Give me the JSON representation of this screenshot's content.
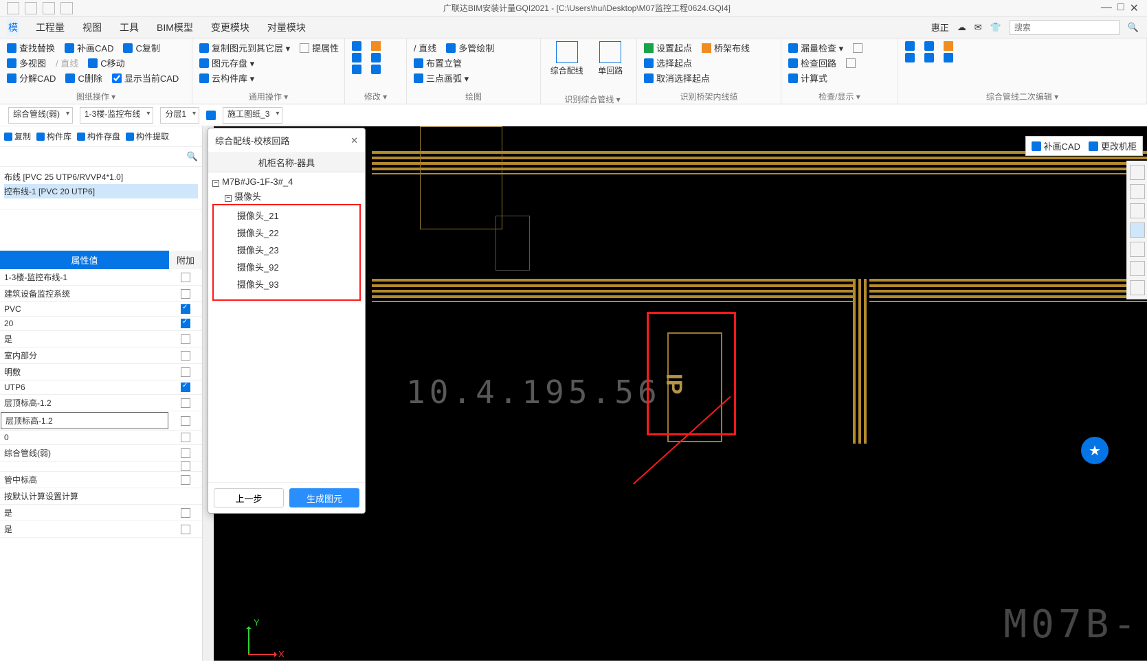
{
  "titlebar": {
    "title": "广联达BIM安装计量GQI2021 - [C:\\Users\\hui\\Desktop\\M07监控工程0624.GQI4]",
    "min": "—",
    "max": "□",
    "close": "✕"
  },
  "menubar": {
    "tabs": [
      "模",
      "工程量",
      "视图",
      "工具",
      "BIM模型",
      "变更模块",
      "对量模块"
    ],
    "user": "惠正",
    "search_placeholder": "搜索"
  },
  "ribbon": {
    "g_draw": {
      "label": "图纸操作 ▾",
      "r1": [
        "查找替换",
        "补画CAD",
        "C复制"
      ],
      "r2": [
        "多视图",
        "/ 直线",
        "C移动"
      ],
      "r3": [
        "分解CAD",
        "C删除"
      ],
      "chkShowCad": "显示当前CAD"
    },
    "g_common": {
      "label": "通用操作 ▾",
      "r1": [
        "复制图元到其它层 ▾",
        "提属性"
      ],
      "r2": [
        "图元存盘 ▾"
      ],
      "r3": [
        "云构件库 ▾"
      ]
    },
    "g_modify": {
      "label": "修改 ▾"
    },
    "g_draw2": {
      "label": "绘图",
      "r1": [
        "/ 直线",
        "多管绘制"
      ],
      "r2": [
        "布置立管"
      ],
      "r3": [
        "三点画弧 ▾"
      ]
    },
    "g_recognize": {
      "label": "识别综合管线 ▾",
      "big1": "综合配线",
      "big2": "单回路"
    },
    "g_bridge": {
      "label": "识别桥架内线缆",
      "r1": [
        "设置起点",
        "桥架布线"
      ],
      "r2": [
        "选择起点"
      ],
      "r3": [
        "取消选择起点"
      ]
    },
    "g_check": {
      "label": "检查/显示 ▾",
      "r1": [
        "漏量检查 ▾"
      ],
      "r2": [
        "检查回路"
      ],
      "r3": [
        "计算式"
      ]
    },
    "g_edit": {
      "label": "综合管线二次编辑 ▾"
    }
  },
  "dropdowns": [
    "综合管线(弱)",
    "1-3楼-监控布线",
    "分层1",
    "施工图纸_3"
  ],
  "left": {
    "bar": [
      "复制",
      "构件库",
      "构件存盘",
      "构件提取"
    ],
    "tree": [
      "布线 [PVC 25 UTP6/RVVP4*1.0]",
      "控布线-1 [PVC 20 UTP6]"
    ],
    "prop_header": {
      "v": "属性值",
      "a": "附加"
    },
    "rows": [
      {
        "v": "1-3楼-监控布线-1",
        "chk": 0
      },
      {
        "v": "建筑设备监控系统",
        "chk": 0
      },
      {
        "v": "PVC",
        "chk": 1
      },
      {
        "v": "20",
        "chk": 1
      },
      {
        "v": "是",
        "chk": 0
      },
      {
        "v": "室内部分",
        "chk": 0
      },
      {
        "v": "明敷",
        "chk": 0
      },
      {
        "v": "UTP6",
        "chk": 1
      },
      {
        "v": "层顶标高-1.2",
        "chk": 0
      },
      {
        "v": "层顶标高-1.2",
        "chk": 0,
        "boxed": 1
      },
      {
        "v": "0",
        "chk": 0
      },
      {
        "v": "综合管线(弱)",
        "chk": 0
      },
      {
        "v": "",
        "chk": 0
      },
      {
        "v": "管中标高",
        "chk": 0
      },
      {
        "v": "按默认计算设置计算",
        "chk": -1
      },
      {
        "v": "是",
        "chk": 0
      },
      {
        "v": "是",
        "chk": 0
      }
    ]
  },
  "popup": {
    "title": "综合配线-校核回路",
    "col": "机柜名称-器具",
    "root": "M7B#JG-1F-3#_4",
    "group": "摄像头",
    "items": [
      "摄像头_21",
      "摄像头_22",
      "摄像头_23",
      "摄像头_92",
      "摄像头_93"
    ],
    "prev": "上一步",
    "gen": "生成图元"
  },
  "canvas": {
    "overlay_btn1": "补画CAD",
    "overlay_btn2": "更改机柜",
    "ip_text": "IP",
    "dim_text": "10.4.195.56",
    "corner": "M07B-",
    "axis_y": "Y",
    "axis_x": "X",
    "star": "★"
  }
}
